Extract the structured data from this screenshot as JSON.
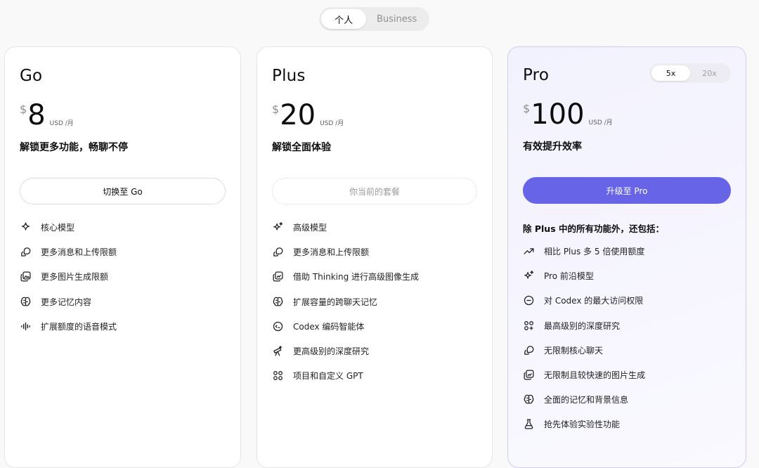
{
  "segment": {
    "personal": "个人",
    "business": "Business"
  },
  "plans": [
    {
      "name": "Go",
      "currency": "$",
      "price": "8",
      "unit": "USD /月",
      "tagline": "解锁更多功能，畅聊不停",
      "cta": "切换至 Go",
      "features": [
        {
          "icon": "sparkle-icon",
          "label": "核心模型"
        },
        {
          "icon": "chat-bubbles-icon",
          "label": "更多消息和上传限额"
        },
        {
          "icon": "image-icon",
          "label": "更多图片生成限额"
        },
        {
          "icon": "brain-icon",
          "label": "更多记忆内容"
        },
        {
          "icon": "voice-wave-icon",
          "label": "扩展额度的语音模式"
        }
      ]
    },
    {
      "name": "Plus",
      "currency": "$",
      "price": "20",
      "unit": "USD /月",
      "tagline": "解锁全面体验",
      "cta": "你当前的套餐",
      "features": [
        {
          "icon": "sparkles-icon",
          "label": "高级模型"
        },
        {
          "icon": "chat-bubbles-icon",
          "label": "更多消息和上传限额"
        },
        {
          "icon": "image-edit-icon",
          "label": "借助 Thinking 进行高级图像生成"
        },
        {
          "icon": "brain-icon",
          "label": "扩展容量的跨聊天记忆"
        },
        {
          "icon": "code-face-icon",
          "label": "Codex 编码智能体"
        },
        {
          "icon": "telescope-icon",
          "label": "更高级别的深度研究"
        },
        {
          "icon": "apps-icon",
          "label": "项目和自定义 GPT"
        }
      ]
    },
    {
      "name": "Pro",
      "currency": "$",
      "price": "100",
      "unit": "USD /月",
      "tagline": "有效提升效率",
      "cta": "升级至 Pro",
      "tiers": [
        "5x",
        "20x"
      ],
      "features_heading": "除 Plus 中的所有功能外，还包括：",
      "features": [
        {
          "icon": "trend-up-icon",
          "label": "相比 Plus 多 5 倍使用额度"
        },
        {
          "icon": "sparkles-icon",
          "label": "Pro 前沿模型"
        },
        {
          "icon": "code-face-icon",
          "label": "对 Codex 的最大访问权限"
        },
        {
          "icon": "apps-icon",
          "label": "最高级别的深度研究"
        },
        {
          "icon": "chat-bubbles-icon",
          "label": "无限制核心聊天"
        },
        {
          "icon": "image-edit-icon",
          "label": "无限制且较快速的图片生成"
        },
        {
          "icon": "brain-icon",
          "label": "全面的记忆和背景信息"
        },
        {
          "icon": "flask-icon",
          "label": "抢先体验实验性功能"
        }
      ]
    }
  ],
  "colors": {
    "accent": "#6864e8",
    "pro_border": "#cfcbf6"
  }
}
